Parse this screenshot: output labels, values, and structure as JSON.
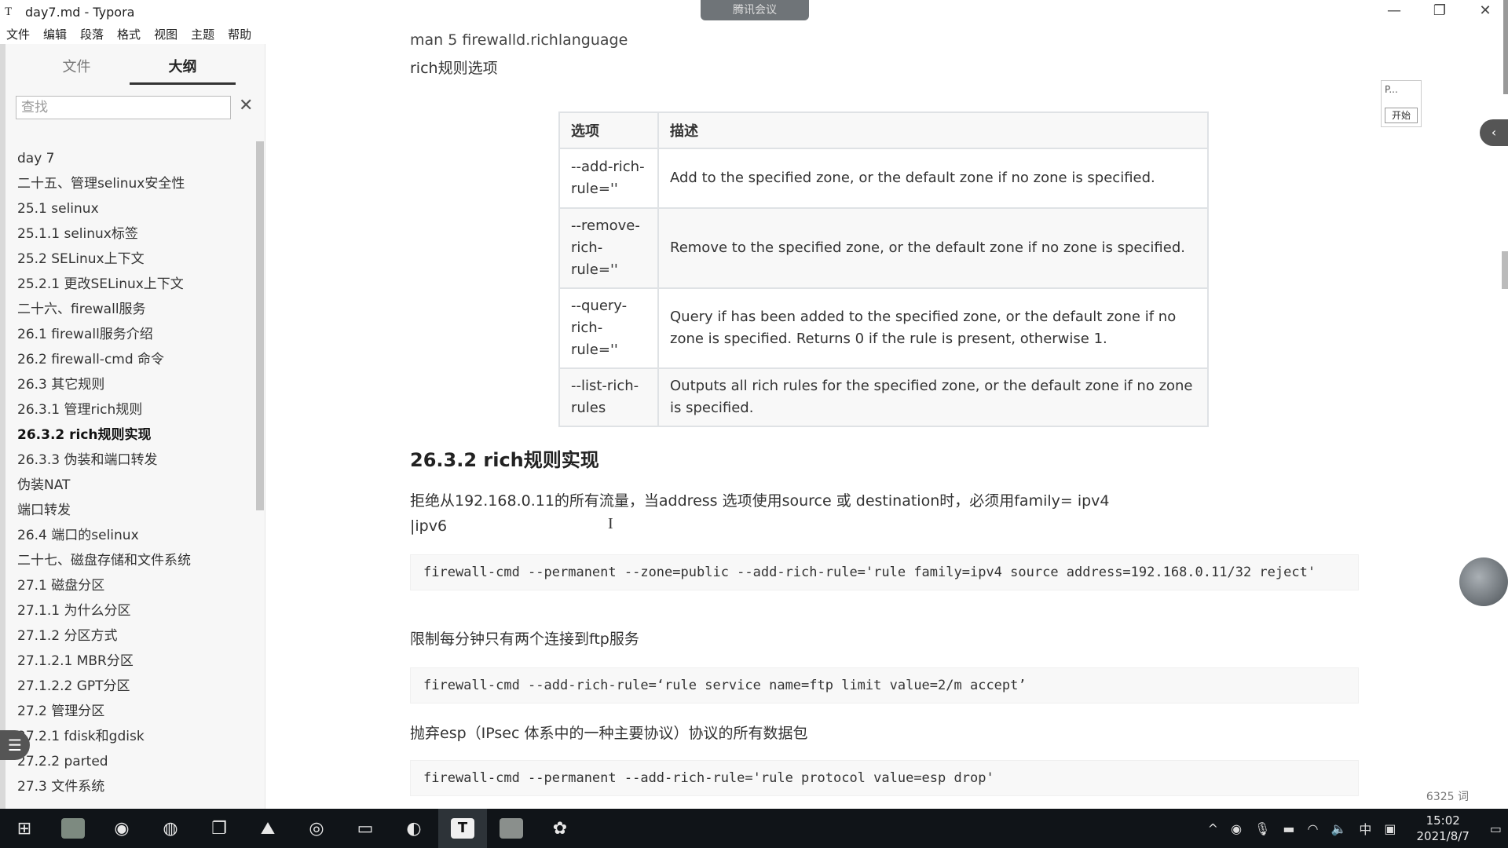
{
  "window": {
    "title": "day7.md - Typora",
    "app_icon": "T",
    "meeting_label": "腾讯会议"
  },
  "window_controls": {
    "minimize": "—",
    "maximize": "❐",
    "close": "✕"
  },
  "menu": [
    "文件",
    "编辑",
    "段落",
    "格式",
    "视图",
    "主题",
    "帮助"
  ],
  "sidebar": {
    "tabs": [
      "文件",
      "大纲"
    ],
    "active_tab": "大纲",
    "search_placeholder": "查找",
    "outline": [
      {
        "label": "day 7",
        "level": 1
      },
      {
        "label": "二十五、管理selinux安全性",
        "level": 2
      },
      {
        "label": "25.1 selinux",
        "level": 3
      },
      {
        "label": "25.1.1 selinux标签",
        "level": 4
      },
      {
        "label": "25.2 SELinux上下文",
        "level": 3
      },
      {
        "label": "25.2.1 更改SELinux上下文",
        "level": 4
      },
      {
        "label": "二十六、firewall服务",
        "level": 2
      },
      {
        "label": "26.1 firewall服务介绍",
        "level": 3
      },
      {
        "label": "26.2 firewall-cmd 命令",
        "level": 3
      },
      {
        "label": "26.3 其它规则",
        "level": 3
      },
      {
        "label": "26.3.1 管理rich规则",
        "level": 4
      },
      {
        "label": "26.3.2 rich规则实现",
        "level": 4,
        "active": true
      },
      {
        "label": "26.3.3 伪装和端口转发",
        "level": 4
      },
      {
        "label": "伪装NAT",
        "level": 5
      },
      {
        "label": "端口转发",
        "level": 5
      },
      {
        "label": "26.4 端口的selinux",
        "level": 3
      },
      {
        "label": "二十七、磁盘存储和文件系统",
        "level": 2
      },
      {
        "label": "27.1 磁盘分区",
        "level": 3
      },
      {
        "label": "27.1.1 为什么分区",
        "level": 4
      },
      {
        "label": "27.1.2 分区方式",
        "level": 4
      },
      {
        "label": "27.1.2.1 MBR分区",
        "level": 5
      },
      {
        "label": "27.1.2.2 GPT分区",
        "level": 5
      },
      {
        "label": "27.2 管理分区",
        "level": 3
      },
      {
        "label": "27.2.1 fdisk和gdisk",
        "level": 4
      },
      {
        "label": "27.2.2 parted",
        "level": 4
      },
      {
        "label": "27.3 文件系统",
        "level": 3
      }
    ],
    "bottom_icons": [
      "‹",
      "</>"
    ]
  },
  "content": {
    "cut_line": "man 5 firewalld.richlanguage",
    "rich_options_heading": "rich规则选项",
    "table": {
      "headers": [
        "选项",
        "描述"
      ],
      "rows": [
        {
          "opt": "--add-rich-rule=''",
          "desc": "Add to the specified zone, or the default zone if no zone is specified."
        },
        {
          "opt": "--remove-rich-rule=''",
          "desc": "Remove to the specified zone, or the default zone if no zone is specified."
        },
        {
          "opt": "--query-rich-rule=''",
          "desc": "Query if has been added to the specified zone, or the default zone if no zone is specified. Returns 0 if the rule is present, otherwise 1."
        },
        {
          "opt": "--list-rich-rules",
          "desc": "Outputs all rich rules for the specified zone, or the default zone if no zone is specified."
        }
      ]
    },
    "section_title": "26.3.2 rich规则实现",
    "para1_line1": "拒绝从192.168.0.11的所有流量，当address 选项使用source 或 destination时，必须用family= ipv4",
    "para1_line2": "|ipv6",
    "code1": "firewall-cmd --permanent --zone=public --add-rich-rule='rule family=ipv4 source address=192.168.0.11/32 reject'",
    "para2": "限制每分钟只有两个连接到ftp服务",
    "code2": "firewall-cmd --add-rich-rule=‘rule service name=ftp limit value=2/m accept’",
    "para3": "抛弃esp（IPsec 体系中的一种主要协议）协议的所有数据包",
    "code3": "firewall-cmd --permanent --add-rich-rule='rule protocol value=esp drop'",
    "word_count": "6325 词"
  },
  "overlay": {
    "widget_text": "P...",
    "start_button": "开始"
  },
  "taskbar": {
    "apps": [
      "windows-start-icon",
      "image-app-icon",
      "chrome-icon",
      "wechat-icon",
      "vm-icon",
      "photos-icon",
      "netease-music-icon",
      "file-explorer-icon",
      "edge-icon",
      "typora-icon",
      "image-app-icon",
      "meeting-icon"
    ],
    "tray_labels": [
      "^",
      "中"
    ],
    "time": "15:02",
    "date": "2021/8/7"
  }
}
